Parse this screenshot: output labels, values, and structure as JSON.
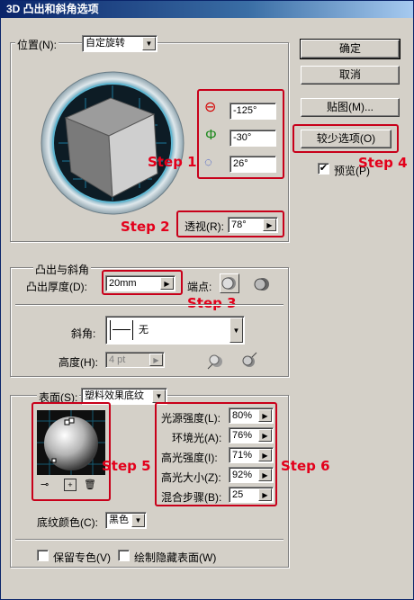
{
  "window": {
    "title": "3D 凸出和斜角选项"
  },
  "position": {
    "label": "位置(N):",
    "preset": "自定旋转",
    "rotation_x": "-125°",
    "rotation_y": "-30°",
    "rotation_z": "26°",
    "perspective_label": "透视(R):",
    "perspective_value": "78°"
  },
  "buttons": {
    "ok": "确定",
    "cancel": "取消",
    "map_art": "贴图(M)...",
    "fewer_options": "较少选项(O)"
  },
  "preview": {
    "label": "预览(P)",
    "checked": true
  },
  "extrude": {
    "group_title": "凸出与斜角",
    "depth_label": "凸出厚度(D):",
    "depth_value": "20mm",
    "cap_label": "端点:",
    "bevel_label": "斜角:",
    "bevel_value": "无",
    "height_label": "高度(H):",
    "height_value": "4 pt"
  },
  "surface": {
    "label": "表面(S):",
    "value": "塑料效果底纹",
    "light_intensity_label": "光源强度(L):",
    "light_intensity_value": "80%",
    "ambient_label": "环境光(A):",
    "ambient_value": "76%",
    "highlight_intensity_label": "高光强度(I):",
    "highlight_intensity_value": "71%",
    "highlight_size_label": "高光大小(Z):",
    "highlight_size_value": "92%",
    "blend_steps_label": "混合步骤(B):",
    "blend_steps_value": "25",
    "shade_color_label": "底纹颜色(C):",
    "shade_color_value": "黑色",
    "preserve_spot_label": "保留专色(V)",
    "draw_hidden_label": "绘制隐藏表面(W)"
  },
  "steps": {
    "s1": "Step 1",
    "s2": "Step 2",
    "s3": "Step 3",
    "s4": "Step 4",
    "s5": "Step 5",
    "s6": "Step 6"
  },
  "colors": {
    "annotation": "#e3001b",
    "titlebar": "#0a246a",
    "dialog": "#d4d0c8"
  }
}
